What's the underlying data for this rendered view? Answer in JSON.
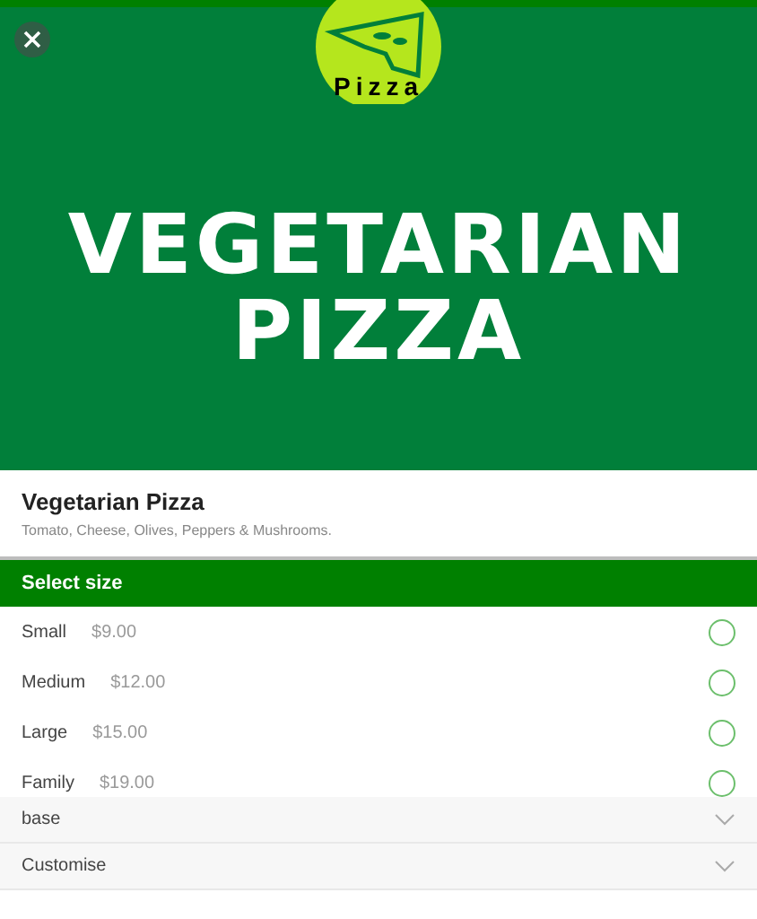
{
  "banner": {
    "logo_text": "Pizza",
    "title_lines": [
      "VEGETARIAN",
      "PIZZA"
    ]
  },
  "product": {
    "name": "Vegetarian Pizza",
    "description": "Tomato, Cheese, Olives, Peppers & Mushrooms."
  },
  "size_section": {
    "title": "Select size",
    "options": [
      {
        "label": "Small",
        "price": "$9.00",
        "selected": false
      },
      {
        "label": "Medium",
        "price": "$12.00",
        "selected": false
      },
      {
        "label": "Large",
        "price": "$15.00",
        "selected": false
      },
      {
        "label": "Family",
        "price": "$19.00",
        "selected": false
      }
    ]
  },
  "panels": [
    {
      "label": "base",
      "expanded": false
    },
    {
      "label": "Customise",
      "expanded": false
    }
  ]
}
